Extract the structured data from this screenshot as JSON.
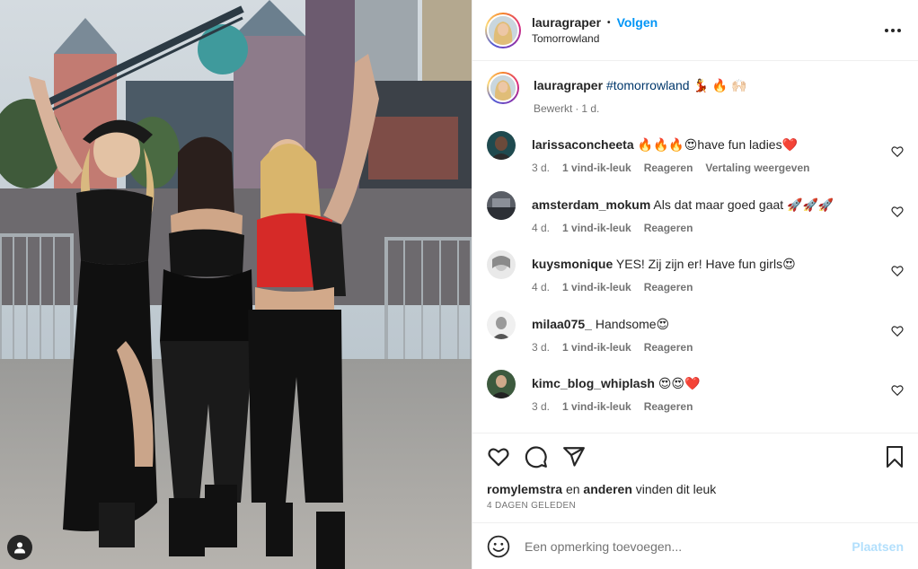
{
  "header": {
    "username": "lauragraper",
    "separator": "•",
    "follow_label": "Volgen",
    "location": "Tomorrowland",
    "more_icon": "more-horizontal-icon"
  },
  "caption": {
    "username": "lauragraper",
    "hashtag": "#tomorrowland",
    "emojis": "💃 🔥 🙌🏻",
    "edited": "Bewerkt",
    "time": "1 d."
  },
  "comments": [
    {
      "username": "larissaconcheeta",
      "text": "🔥🔥🔥😍have fun ladies❤️",
      "time": "3 d.",
      "likes": "1 vind-ik-leuk",
      "reply": "Reageren",
      "translate": "Vertaling weergeven"
    },
    {
      "username": "amsterdam_mokum",
      "text": "Als dat maar goed gaat 🚀🚀🚀",
      "time": "4 d.",
      "likes": "1 vind-ik-leuk",
      "reply": "Reageren"
    },
    {
      "username": "kuysmonique",
      "text": "YES! Zij zijn er! Have fun girls😍",
      "time": "4 d.",
      "likes": "1 vind-ik-leuk",
      "reply": "Reageren"
    },
    {
      "username": "milaa075_",
      "text": "Handsome😍",
      "time": "3 d.",
      "likes": "1 vind-ik-leuk",
      "reply": "Reageren"
    },
    {
      "username": "kimc_blog_whiplash",
      "text": "😍😍❤️",
      "time": "3 d.",
      "likes": "1 vind-ik-leuk",
      "reply": "Reageren"
    }
  ],
  "actions": {
    "like_icon": "heart-icon",
    "comment_icon": "comment-icon",
    "share_icon": "send-icon",
    "save_icon": "bookmark-icon"
  },
  "likes": {
    "user": "romylemstra",
    "joiner": "en",
    "others": "anderen",
    "suffix": "vinden dit leuk"
  },
  "posted_ago": "4 DAGEN GELEDEN",
  "add_comment": {
    "placeholder": "Een opmerking toevoegen...",
    "post_label": "Plaatsen",
    "emoji_icon": "smiley-icon"
  },
  "colors": {
    "accent": "#0095f6",
    "post_disabled": "#b2dffc",
    "muted": "#737373",
    "text": "#262626",
    "hashtag": "#00376b"
  }
}
